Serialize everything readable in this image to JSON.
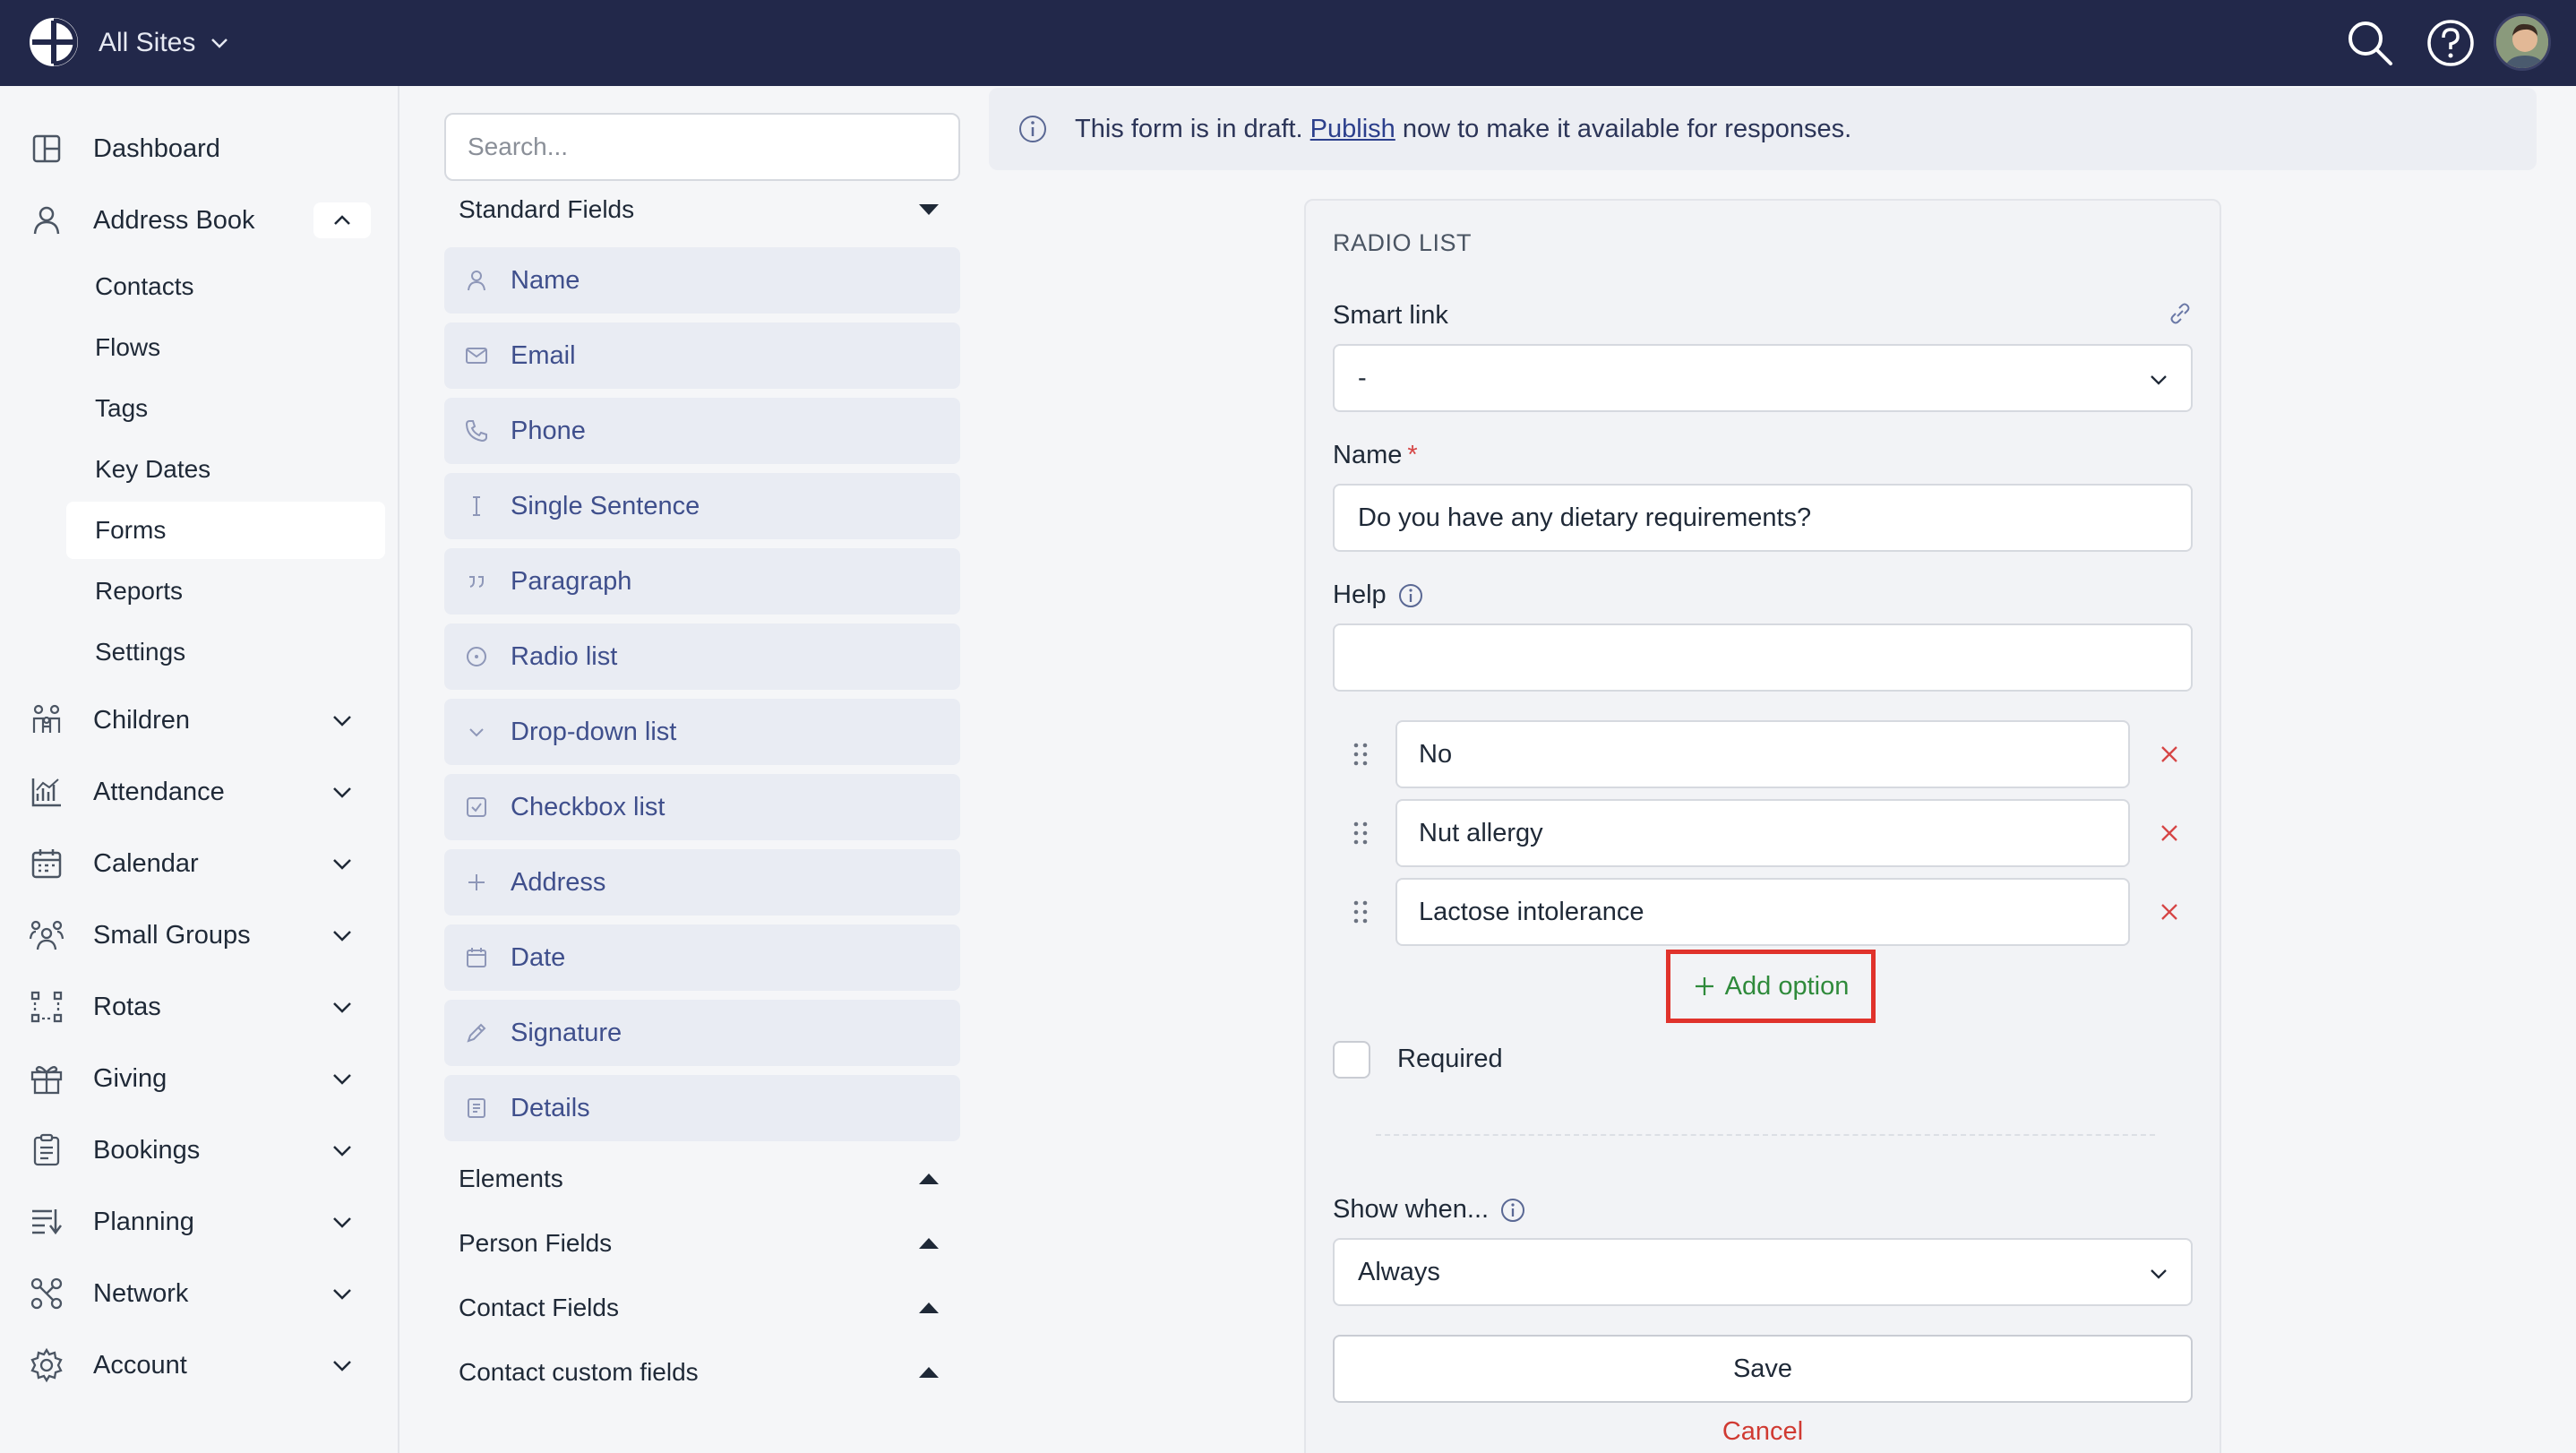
{
  "topbar": {
    "site_switcher_label": "All Sites",
    "icons": [
      "globe-logo-icon",
      "search-icon",
      "help-icon",
      "avatar"
    ]
  },
  "sidebar": {
    "items": [
      {
        "label": "Dashboard",
        "icon": "dashboard-icon"
      },
      {
        "label": "Address Book",
        "icon": "person-icon",
        "expanded": true,
        "children": [
          "Contacts",
          "Flows",
          "Tags",
          "Key Dates",
          "Forms",
          "Reports",
          "Settings"
        ],
        "active_child": "Forms"
      },
      {
        "label": "Children",
        "icon": "children-icon"
      },
      {
        "label": "Attendance",
        "icon": "attendance-chart-icon"
      },
      {
        "label": "Calendar",
        "icon": "calendar-icon"
      },
      {
        "label": "Small Groups",
        "icon": "group-icon"
      },
      {
        "label": "Rotas",
        "icon": "rotas-icon"
      },
      {
        "label": "Giving",
        "icon": "gift-icon"
      },
      {
        "label": "Bookings",
        "icon": "clipboard-icon"
      },
      {
        "label": "Planning",
        "icon": "planning-icon"
      },
      {
        "label": "Network",
        "icon": "network-icon"
      },
      {
        "label": "Account",
        "icon": "gear-icon"
      }
    ]
  },
  "palette": {
    "search_placeholder": "Search...",
    "standard_fields_label": "Standard Fields",
    "fields": [
      {
        "label": "Name",
        "icon": "person-icon"
      },
      {
        "label": "Email",
        "icon": "envelope-icon"
      },
      {
        "label": "Phone",
        "icon": "phone-icon"
      },
      {
        "label": "Single Sentence",
        "icon": "text-cursor-icon"
      },
      {
        "label": "Paragraph",
        "icon": "quote-icon"
      },
      {
        "label": "Radio list",
        "icon": "radio-icon"
      },
      {
        "label": "Drop-down list",
        "icon": "dropdown-icon"
      },
      {
        "label": "Checkbox list",
        "icon": "checkbox-icon"
      },
      {
        "label": "Address",
        "icon": "plus-icon"
      },
      {
        "label": "Date",
        "icon": "calendar-icon"
      },
      {
        "label": "Signature",
        "icon": "pen-icon"
      },
      {
        "label": "Details",
        "icon": "details-icon"
      }
    ],
    "groups": [
      "Elements",
      "Person Fields",
      "Contact Fields",
      "Contact custom fields"
    ]
  },
  "banner": {
    "text_before": "This form is in draft. ",
    "link_text": "Publish",
    "text_after": " now to make it available for responses."
  },
  "editor": {
    "title": "RADIO LIST",
    "smart_link_label": "Smart link",
    "smart_link_value": "-",
    "name_label": "Name",
    "name_required_mark": "*",
    "name_value": "Do you have any dietary requirements?",
    "help_label": "Help",
    "help_value": "",
    "options": [
      "No",
      "Nut allergy",
      "Lactose intolerance"
    ],
    "add_option_label": "Add option",
    "required_label": "Required",
    "required_checked": false,
    "show_when_label": "Show when...",
    "show_when_value": "Always",
    "save_label": "Save",
    "cancel_label": "Cancel"
  },
  "colors": {
    "topbar": "#22284a",
    "field_text": "#3f4f8c",
    "add_option_green": "#2f8a3b",
    "highlight_red": "#e0322b",
    "cancel_red": "#d03a32"
  }
}
